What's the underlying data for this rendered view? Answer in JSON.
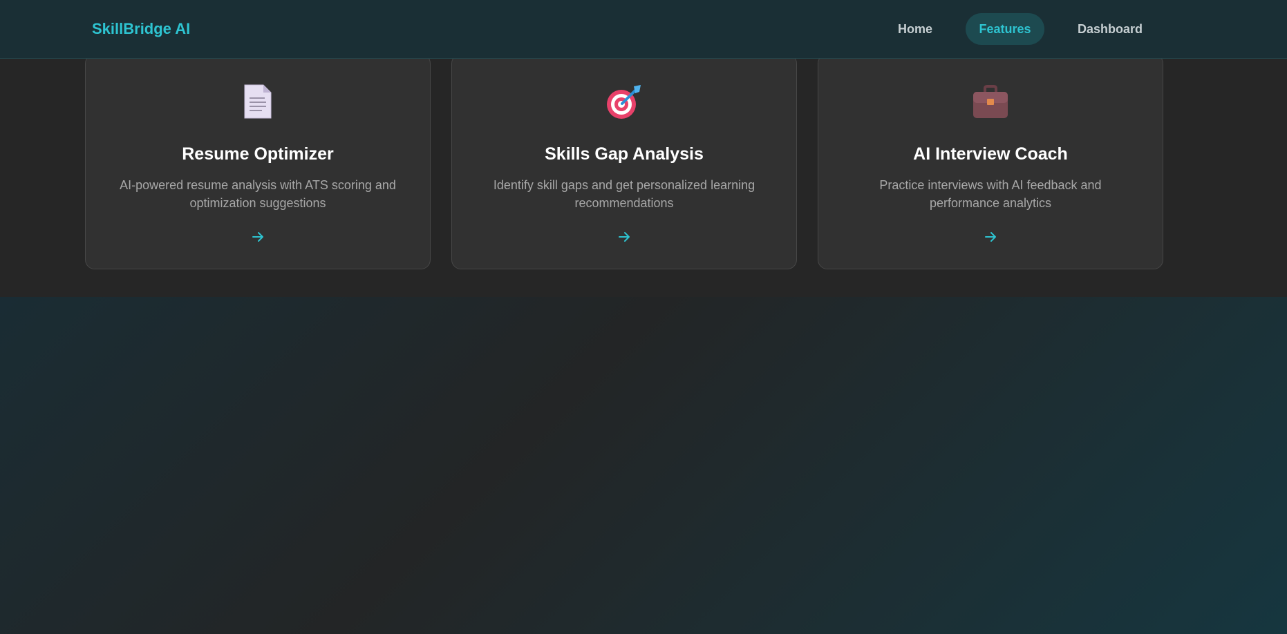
{
  "brand": "SkillBridge AI",
  "nav": {
    "home": "Home",
    "features": "Features",
    "dashboard": "Dashboard",
    "active": "Features"
  },
  "cards": [
    {
      "title": "Resume Optimizer",
      "description": "AI-powered resume analysis with ATS scoring and optimization suggestions",
      "icon": "document-icon",
      "arrow": "arrow-right-icon"
    },
    {
      "title": "Skills Gap Analysis",
      "description": "Identify skill gaps and get personalized learning recommendations",
      "icon": "target-icon",
      "arrow": "arrow-right-icon"
    },
    {
      "title": "AI Interview Coach",
      "description": "Practice interviews with AI feedback and performance analytics",
      "icon": "briefcase-icon",
      "arrow": "arrow-right-icon"
    }
  ],
  "colors": {
    "accent": "#2ec4d1",
    "nav_bg": "#1a2f35",
    "card_bg": "#313131",
    "section_bg": "#262626"
  }
}
